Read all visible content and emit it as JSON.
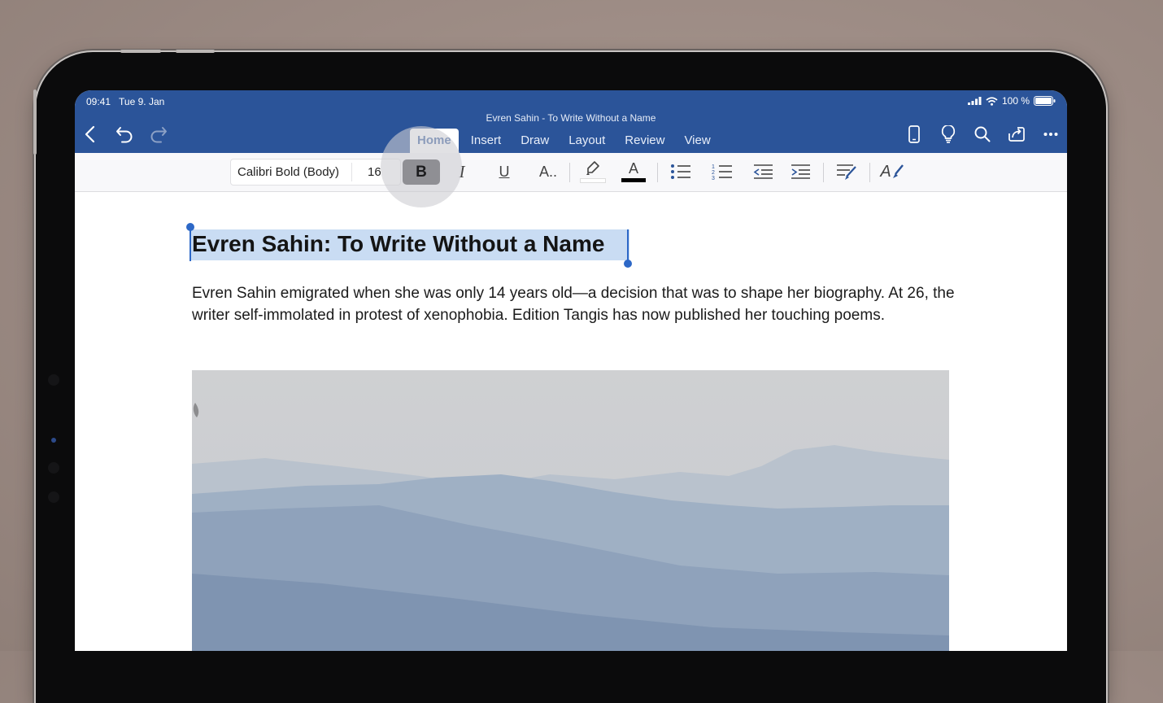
{
  "status_bar": {
    "time": "09:41",
    "date": "Tue 9. Jan",
    "battery": "100 %"
  },
  "app": {
    "document_title": "Evren Sahin - To Write Without a Name",
    "tabs": [
      "Home",
      "Insert",
      "Draw",
      "Layout",
      "Review",
      "View"
    ],
    "active_tab": "Home"
  },
  "ribbon": {
    "font_name": "Calibri Bold (Body)",
    "font_size": "16",
    "bold": "B",
    "italic": "I",
    "underline": "U",
    "text_effects": "A..",
    "font_color_letter": "A",
    "font_color": "#000000",
    "highlight_color": "#ffffff",
    "styles_letter": "A"
  },
  "document": {
    "heading": "Evren Sahin: To Write Without a Name",
    "paragraph": "Evren Sahin emigrated when she was only 14 years old—a decision that was to shape her biography. At 26, the writer self-immolated in protest of xenophobia. Edition Tangis has now published her touching poems."
  },
  "colors": {
    "titlebar": "#2b5499",
    "selection": "#c9dcf3",
    "cursor": "#2d68c7"
  }
}
